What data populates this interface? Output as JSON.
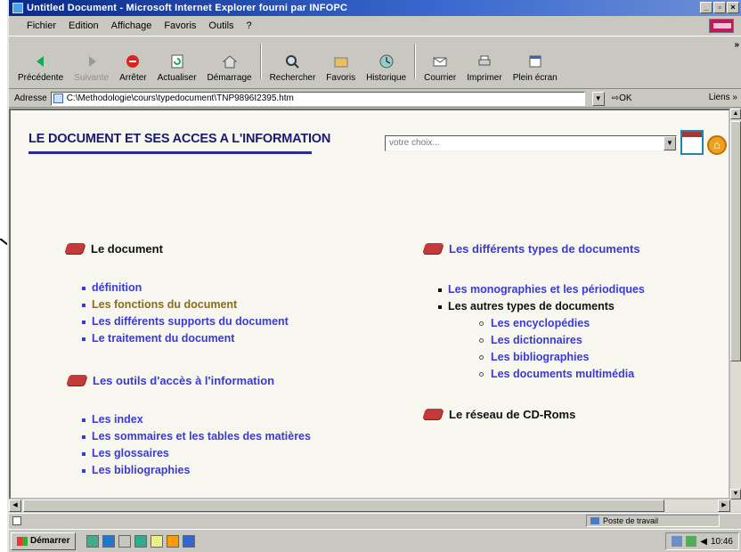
{
  "window": {
    "title": "Untitled Document - Microsoft Internet Explorer fourni par INFOPC"
  },
  "menu": {
    "items": [
      "Fichier",
      "Edition",
      "Affichage",
      "Favoris",
      "Outils",
      "?"
    ]
  },
  "toolbar": {
    "back": "Précédente",
    "forward": "Suivante",
    "stop": "Arrêter",
    "refresh": "Actualiser",
    "home": "Démarrage",
    "search": "Rechercher",
    "favorites": "Favoris",
    "history": "Historique",
    "mail": "Courrier",
    "print": "Imprimer",
    "fullscreen": "Plein écran"
  },
  "address": {
    "label": "Adresse",
    "url": "C:\\Methodologie\\cours\\typedocument\\TNP9896I2395.htm",
    "go": "OK",
    "links": "Liens"
  },
  "page": {
    "title": "LE DOCUMENT ET SES ACCES A L'INFORMATION",
    "choice_placeholder": "votre choix...",
    "sections": {
      "document": {
        "heading": "Le document",
        "items": [
          "définition",
          "Les fonctions du document",
          "Les différents supports du document",
          "Le traitement du document"
        ]
      },
      "outils": {
        "heading": "Les outils d'accès à l'information",
        "items": [
          "Les index",
          "Les sommaires et les tables des matières",
          "Les glossaires",
          "Les bibliographies"
        ]
      },
      "types": {
        "heading": "Les différents types de documents",
        "items": [
          "Les monographies et les périodiques",
          "Les autres types de documents"
        ],
        "subitems": [
          "Les encyclopédies",
          "Les dictionnaires",
          "Les bibliographies",
          "Les documents multimédia"
        ]
      },
      "reseau": {
        "heading": "Le réseau de CD-Roms"
      }
    }
  },
  "statusbar": {
    "zone": "Poste de travail"
  },
  "taskbar": {
    "start": "Démarrer",
    "clock": "10:46"
  },
  "icons": {
    "section_bullet": "book-icon",
    "calendar": "calendar-icon",
    "home": "home-icon"
  },
  "colors": {
    "link": "#3a3ad6",
    "visited": "#8b6b1a",
    "heading": "#1a1a6e",
    "book": "#c43a3a"
  }
}
